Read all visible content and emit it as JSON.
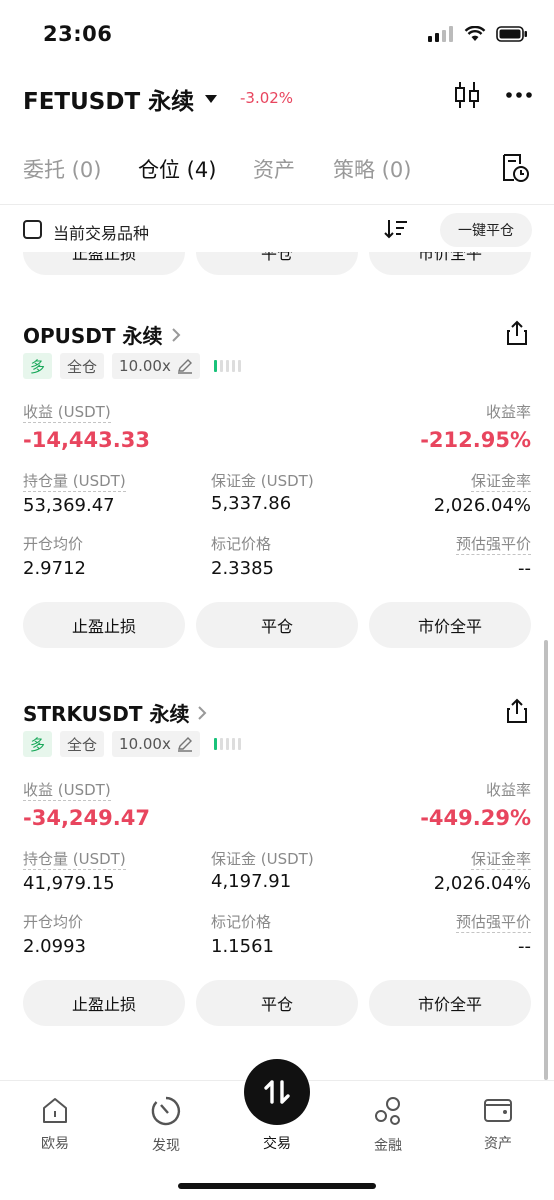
{
  "status": {
    "time": "23:06"
  },
  "header": {
    "pair": "FETUSDT 永续",
    "change": "-3.02%"
  },
  "tabs": [
    {
      "label": "委托 (0)"
    },
    {
      "label": "仓位 (4)"
    },
    {
      "label": "资产"
    },
    {
      "label": "策略 (0)"
    }
  ],
  "filter": {
    "label": "当前交易品种",
    "close_all": "一键平仓"
  },
  "partial_buttons": [
    "止盈止损",
    "平仓",
    "市价全平"
  ],
  "positions": [
    {
      "symbol": "OPUSDT 永续",
      "side": "多",
      "margin_mode": "全仓",
      "leverage": "10.00x",
      "pnl_label": "收益 (USDT)",
      "pnl": "-14,443.33",
      "roe_label": "收益率",
      "roe": "-212.95%",
      "size_label": "持仓量 (USDT)",
      "size": "53,369.47",
      "margin_label": "保证金 (USDT)",
      "margin": "5,337.86",
      "margin_ratio_label": "保证金率",
      "margin_ratio": "2,026.04%",
      "entry_label": "开仓均价",
      "entry": "2.9712",
      "mark_label": "标记价格",
      "mark": "2.3385",
      "liq_label": "预估强平价",
      "liq": "--",
      "buttons": [
        "止盈止损",
        "平仓",
        "市价全平"
      ]
    },
    {
      "symbol": "STRKUSDT 永续",
      "side": "多",
      "margin_mode": "全仓",
      "leverage": "10.00x",
      "pnl_label": "收益 (USDT)",
      "pnl": "-34,249.47",
      "roe_label": "收益率",
      "roe": "-449.29%",
      "size_label": "持仓量 (USDT)",
      "size": "41,979.15",
      "margin_label": "保证金 (USDT)",
      "margin": "4,197.91",
      "margin_ratio_label": "保证金率",
      "margin_ratio": "2,026.04%",
      "entry_label": "开仓均价",
      "entry": "2.0993",
      "mark_label": "标记价格",
      "mark": "1.1561",
      "liq_label": "预估强平价",
      "liq": "--",
      "buttons": [
        "止盈止损",
        "平仓",
        "市价全平"
      ]
    }
  ],
  "nav": [
    {
      "label": "欧易",
      "icon": "home-icon"
    },
    {
      "label": "发现",
      "icon": "discover-icon"
    },
    {
      "label": "交易",
      "icon": "trade-icon"
    },
    {
      "label": "金融",
      "icon": "finance-icon"
    },
    {
      "label": "资产",
      "icon": "wallet-icon"
    }
  ],
  "colors": {
    "negative": "#e8455e",
    "long": "#19a85a",
    "risk_level": "#19c27a"
  }
}
